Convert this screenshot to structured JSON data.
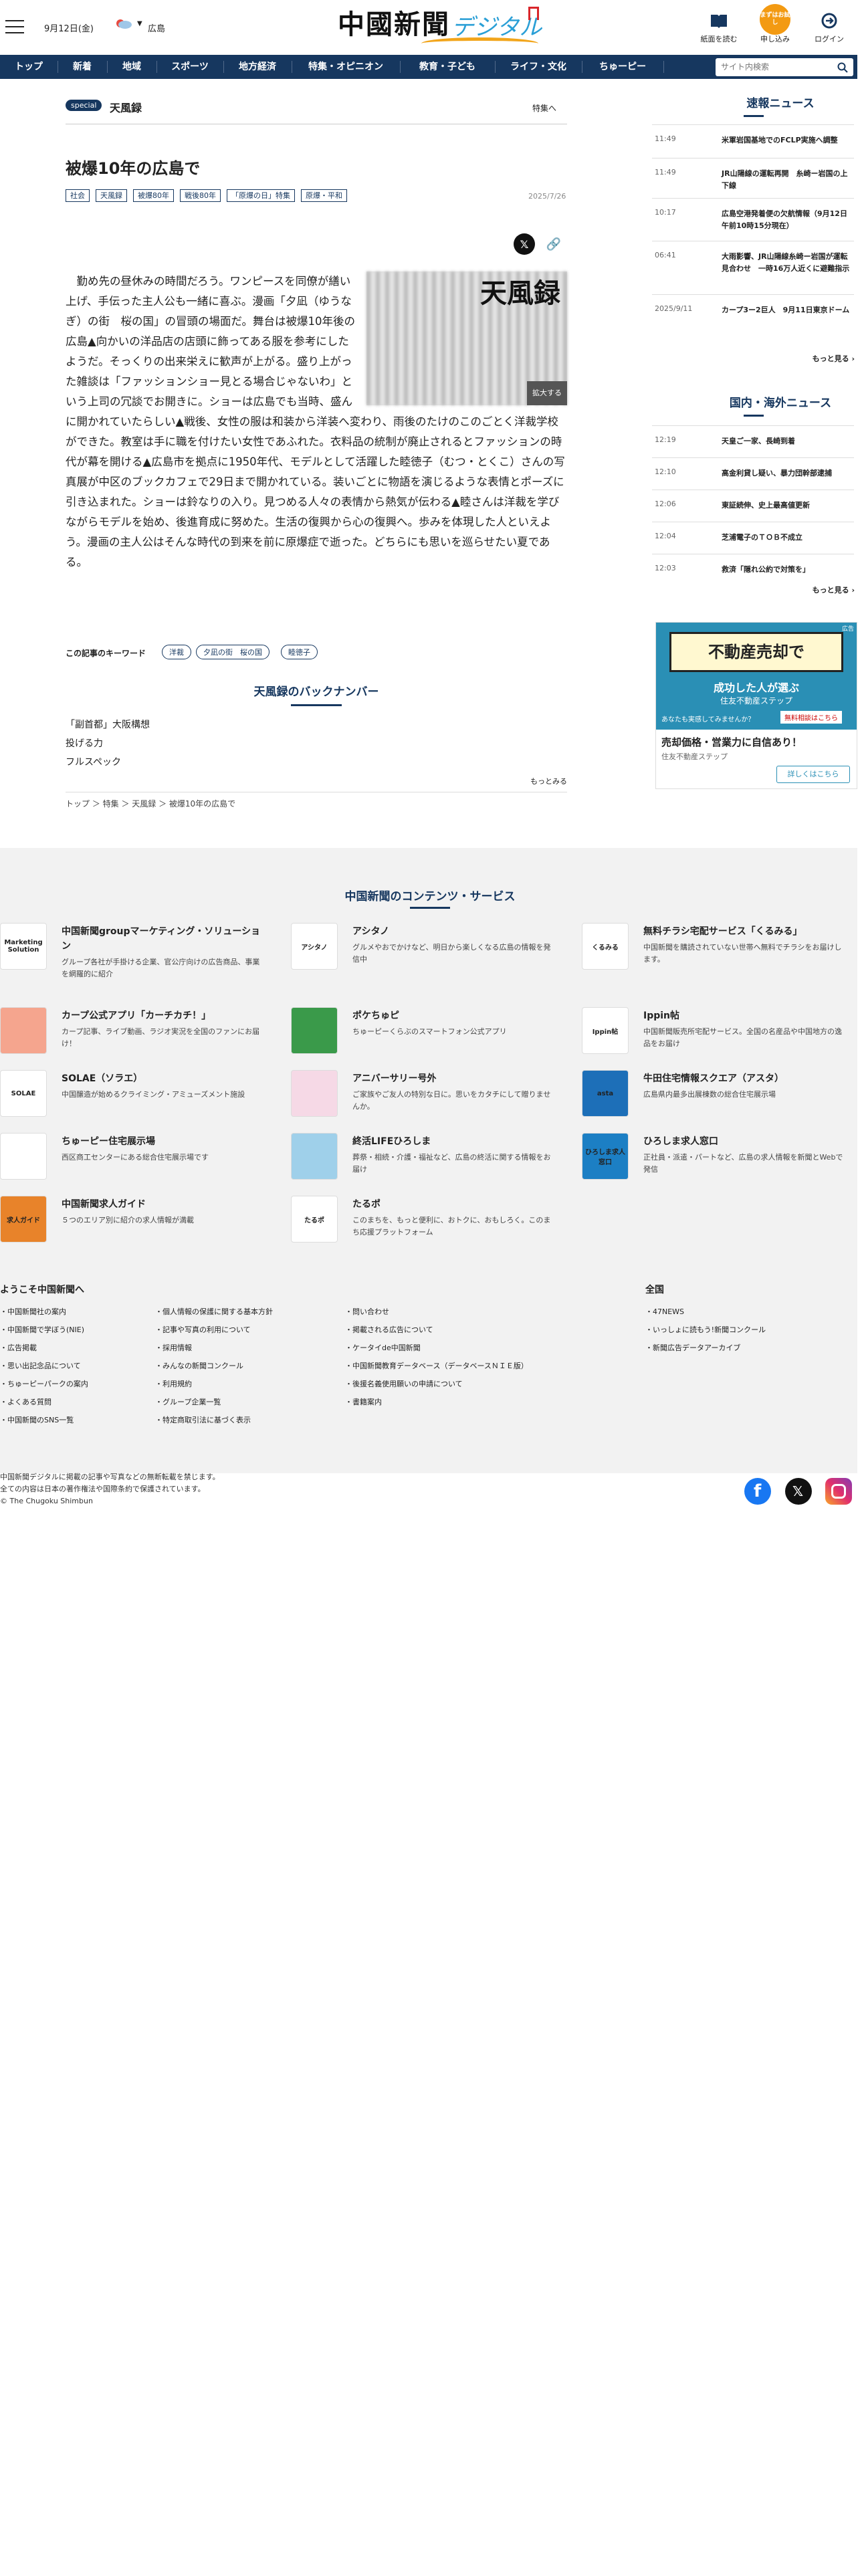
{
  "header": {
    "date": "9月12日(金)",
    "pref": "広島",
    "logo_main": "中國新聞",
    "logo_sub": "デジタル",
    "btn_paper": "紙面を読む",
    "btn_apply_badge": "まずはお試し",
    "btn_apply": "申し込み",
    "btn_login": "ログイン"
  },
  "nav": {
    "items": [
      "トップ",
      "新着",
      "地域",
      "スポーツ",
      "地方経済",
      "特集・オピニオン",
      "教育・子ども",
      "ライフ・文化",
      "ちゅーピー"
    ],
    "search_placeholder": "サイト内検索"
  },
  "article": {
    "special_badge": "special",
    "series": "天風録",
    "tokushu_link": "特集へ",
    "title": "被爆10年の広島で",
    "tags": [
      "社会",
      "天風録",
      "被爆80年",
      "戦後80年",
      "「原爆の日」特集",
      "原爆・平和"
    ],
    "date": "2025/7/26",
    "image_title": "天風録",
    "zoom": "拡大する",
    "body": "　勤め先の昼休みの時間だろう。ワンピースを同僚が繕い上げ、手伝った主人公も一緒に喜ぶ。漫画「夕凪（ゆうなぎ）の街　桜の国」の冒頭の場面だ。舞台は被爆10年後の広島▲向かいの洋品店の店頭に飾ってある服を参考にしたようだ。そっくりの出来栄えに歓声が上がる。盛り上がった雑談は「ファッションショー見とる場合じゃないわ」という上司の冗談でお開きに。ショーは広島でも当時、盛んに開かれていたらしい▲戦後、女性の服は和装から洋装へ変わり、雨後のたけのこのごとく洋裁学校ができた。教室は手に職を付けたい女性であふれた。衣料品の統制が廃止されるとファッションの時代が幕を開ける▲広島市を拠点に1950年代、モデルとして活躍した睦徳子（むつ・とくこ）さんの写真展が中区のブックカフェで29日まで開かれている。装いごとに物語を演じるような表情とポーズに引き込まれた。ショーは鈴なりの入り。見つめる人々の表情から熱気が伝わる▲睦さんは洋裁を学びながらモデルを始め、後進育成に努めた。生活の復興から心の復興へ。歩みを体現した人といえよう。漫画の主人公はそんな時代の到来を前に原爆症で逝った。どちらにも思いを巡らせたい夏である。",
    "kw_label": "この記事のキーワード",
    "keywords": [
      "洋裁",
      "夕凪の街　桜の国",
      "睦徳子"
    ],
    "back_title": "天風録のバックナンバー",
    "back_items": [
      "「副首都」大阪構想",
      "投げる力",
      "フルスペック"
    ],
    "more": "もっとみる",
    "crumbs": "トップ ＞ 特集 ＞ 天風録 ＞ 被爆10年の広島で"
  },
  "sidebar": {
    "breaking_title": "速報ニュース",
    "breaking": [
      {
        "t": "11:49",
        "h": "米軍岩国基地でのFCLP実施へ調整"
      },
      {
        "t": "11:49",
        "h": "JR山陽線の運転再開　糸崎ー岩国の上下線"
      },
      {
        "t": "10:17",
        "h": "広島空港発着便の欠航情報（9月12日午前10時15分現在）"
      },
      {
        "t": "06:41",
        "h": "大雨影響、JR山陽線糸崎ー岩国が運転見合わせ　一時16万人近くに避難指示"
      },
      {
        "t": "2025/9/11",
        "h": "カープ3ー2巨人　9月11日東京ドーム"
      }
    ],
    "more": "もっと見る ›",
    "world_title": "国内・海外ニュース",
    "world": [
      {
        "t": "12:19",
        "h": "天皇ご一家、長崎到着"
      },
      {
        "t": "12:10",
        "h": "高金利貸し疑い、暴力団幹部逮捕"
      },
      {
        "t": "12:06",
        "h": "東証続伸、史上最高値更新"
      },
      {
        "t": "12:04",
        "h": "芝浦電子のＴＯＢ不成立"
      },
      {
        "t": "12:03",
        "h": "救済「隠れ公約で対策を」"
      }
    ],
    "ad_label": "広告",
    "ad_headline": "不動産売却で",
    "ad_sub": "成功した人が選ぶ",
    "ad_brand": "住友不動産ステップ",
    "ad_caption": "あなたも実感してみませんか？",
    "ad_btn_small": "無料相談はこちら",
    "ad_title": "売却価格・営業力に自信あり！",
    "ad_sponsor": "住友不動産ステップ",
    "ad_btn": "詳しくはこちら"
  },
  "footer": {
    "title": "中国新聞のコンテンツ・サービス",
    "services": [
      {
        "name": "中国新聞groupマーケティング・ソリューション",
        "desc": "グループ各社が手掛ける企業、官公庁向けの広告商品、事業を網羅的に紹介",
        "thumb": "Marketing Solution",
        "color": "#ffffff"
      },
      {
        "name": "アシタノ",
        "desc": "グルメやおでかけなど、明日から楽しくなる広島の情報を発信中",
        "thumb": "アシタノ",
        "color": "#ffffff"
      },
      {
        "name": "無料チラシ宅配サービス「くるみる」",
        "desc": "中国新聞を購読されていない世帯へ無料でチラシをお届けします。",
        "thumb": "くるみる",
        "color": "#ffffff"
      },
      {
        "name": "カープ公式アプリ「カーチカチ！」",
        "desc": "カープ記事、ライブ動画、ラジオ実況を全国のファンにお届け！",
        "thumb": "",
        "color": "#f5a58e"
      },
      {
        "name": "ポケちゅピ",
        "desc": "ちゅーピーくらぶのスマートフォン公式アプリ",
        "thumb": "",
        "color": "#3a9a4a"
      },
      {
        "name": "Ippin帖",
        "desc": "中国新聞販売所宅配サービス。全国の名産品や中国地方の逸品をお届け",
        "thumb": "Ippin帖",
        "color": "#ffffff"
      },
      {
        "name": "SOLAE（ソラエ）",
        "desc": "中国醸造が始めるクライミング・アミューズメント施設",
        "thumb": "SOLAE",
        "color": "#ffffff"
      },
      {
        "name": "アニバーサリー号外",
        "desc": "ご家族やご友人の特別な日に。思いをカタチにして贈りませんか。",
        "thumb": "",
        "color": "#f6d9e6"
      },
      {
        "name": "牛田住宅情報スクエア（アスタ）",
        "desc": "広島県内最多出展棟数の総合住宅展示場",
        "thumb": "asta",
        "color": "#1d6fb8"
      },
      {
        "name": "ちゅーピー住宅展示場",
        "desc": "西区商工センターにある総合住宅展示場です",
        "thumb": "",
        "color": "#ffffff"
      },
      {
        "name": "終活LIFEひろしま",
        "desc": "葬祭・相続・介護・福祉など、広島の終活に関する情報をお届け",
        "thumb": "",
        "color": "#9fd0ea"
      },
      {
        "name": "ひろしま求人窓口",
        "desc": "正社員・派遣・パートなど、広島の求人情報を新聞とWebで発信",
        "thumb": "ひろしま求人窓口",
        "color": "#1c7fc4"
      },
      {
        "name": "中国新聞求人ガイド",
        "desc": "５つのエリア別に紹介の求人情報が満載",
        "thumb": "求人ガイド",
        "color": "#e8832a"
      },
      {
        "name": "たるポ",
        "desc": "このまちを、もっと便利に、おトクに、おもしろく。このまち応援プラットフォーム",
        "thumb": "たるポ",
        "color": "#ffffff"
      }
    ],
    "welcome_title": "ようこそ中国新聞へ",
    "nation_title": "全国",
    "col1": [
      "中国新聞社の案内",
      "中国新聞で学ぼう(NIE)",
      "広告掲載",
      "思い出記念品について",
      "ちゅーピーパークの案内",
      "よくある質問",
      "中国新聞のSNS一覧"
    ],
    "col2": [
      "個人情報の保護に関する基本方針",
      "記事や写真の利用について",
      "採用情報",
      "みんなの新聞コンクール",
      "利用規約",
      "グループ企業一覧",
      "特定商取引法に基づく表示"
    ],
    "col3": [
      "問い合わせ",
      "掲載される広告について",
      "ケータイde中国新聞",
      "中国新聞教育データベース（データベースＮＩＥ版）",
      "後援名義使用願いの申請について",
      "書籍案内"
    ],
    "col4": [
      "47NEWS",
      "いっしょに読もう!新聞コンクール",
      "新聞広告データアーカイブ"
    ],
    "copy1": "中国新聞デジタルに掲載の記事や写真などの無断転載を禁じます。",
    "copy2": "全ての内容は日本の著作権法や国際条約で保護されています。",
    "copy3": "© The Chugoku Shimbun"
  }
}
